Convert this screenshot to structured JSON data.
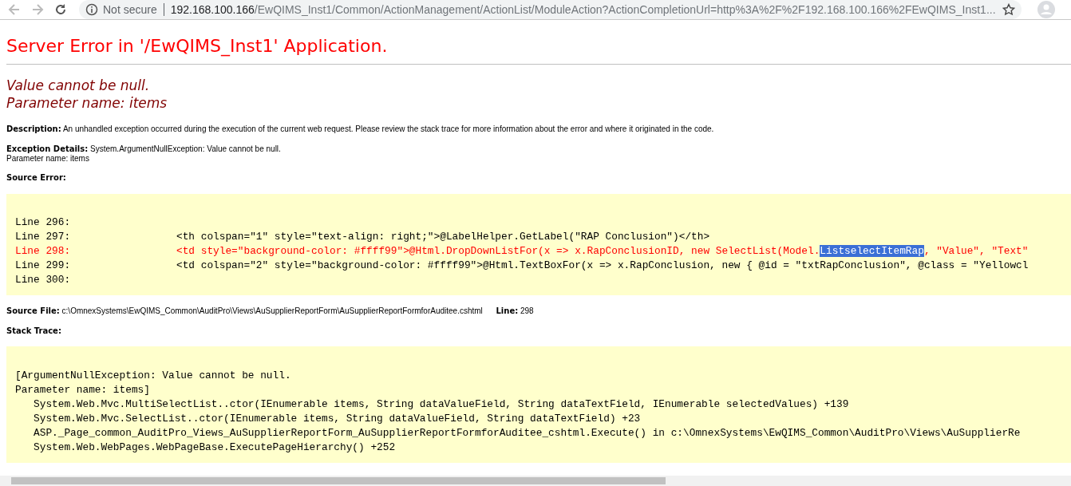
{
  "browser": {
    "security": "Not secure",
    "url_host": "192.168.100.166",
    "url_path": "/EwQIMS_Inst1/Common/ActionManagement/ActionList/ModuleAction?ActionCompletionUrl=http%3A%2F%2F192.168.100.166%2FEwQIMS_Inst1..."
  },
  "title": "Server Error in '/EwQIMS_Inst1' Application.",
  "message": [
    "Value cannot be null.",
    "Parameter name: items"
  ],
  "description": {
    "label": "Description:",
    "text": "An unhandled exception occurred during the execution of the current web request. Please review the stack trace for more information about the error and where it originated in the code."
  },
  "exception_details": {
    "label": "Exception Details:",
    "text": "System.ArgumentNullException: Value cannot be null.",
    "text_2": "Parameter name: items"
  },
  "source_error": {
    "label": "Source Error:",
    "lines": [
      {
        "number": "Line 296:",
        "error": false
      },
      {
        "number": "Line 297:",
        "error": false,
        "segments": [
          {
            "text": "                <th colspan=\"1\" style=\"text-align: right;\">@LabelHelper.GetLabel(\"RAP Conclusion\")</th>",
            "selected": false
          }
        ]
      },
      {
        "number": "Line 298:",
        "error": true,
        "segments": [
          {
            "text": "                <td style=\"background-color: #ffff99\">@Html.DropDownListFor(x => x.RapConclusionID, new SelectList(Model.",
            "selected": false
          },
          {
            "text": "ListselectItemRap",
            "selected": true
          },
          {
            "text": ", \"Value\", \"Text\"",
            "selected": false
          }
        ]
      },
      {
        "number": "Line 299:",
        "error": false,
        "segments": [
          {
            "text": "                <td colspan=\"2\" style=\"background-color: #ffff99\">@Html.TextBoxFor(x => x.RapConclusion, new { @id = \"txtRapConclusion\", @class = \"Yellowcl",
            "selected": false
          }
        ]
      },
      {
        "number": "Line 300:",
        "error": false
      }
    ]
  },
  "source_file": {
    "label": "Source File:",
    "path": "c:\\OmnexSystems\\EwQIMS_Common\\AuditPro\\Views\\AuSupplierReportForm\\AuSupplierReportFormforAuditee.cshtml",
    "line_label": "Line:",
    "line": "298"
  },
  "stack_trace": {
    "label": "Stack Trace:",
    "lines": [
      "[ArgumentNullException: Value cannot be null.",
      "Parameter name: items]",
      "   System.Web.Mvc.MultiSelectList..ctor(IEnumerable items, String dataValueField, String dataTextField, IEnumerable selectedValues) +139",
      "   System.Web.Mvc.SelectList..ctor(IEnumerable items, String dataValueField, String dataTextField) +23",
      "   ASP._Page_common_AuditPro_Views_AuSupplierReportForm_AuSupplierReportFormforAuditee_cshtml.Execute() in c:\\OmnexSystems\\EwQIMS_Common\\AuditPro\\Views\\AuSupplierRe",
      "   System.Web.WebPages.WebPageBase.ExecutePageHierarchy() +252"
    ]
  }
}
